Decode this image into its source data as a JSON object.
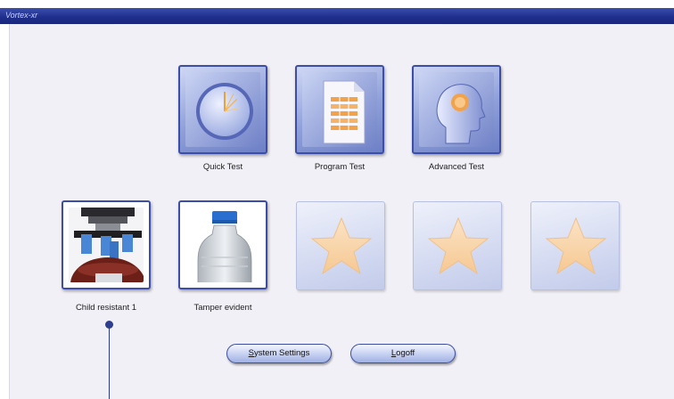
{
  "window": {
    "title": "Vortex-xr"
  },
  "tests": [
    {
      "label": "Quick Test",
      "icon": "clock-icon"
    },
    {
      "label": "Program Test",
      "icon": "document-icon"
    },
    {
      "label": "Advanced Test",
      "icon": "head-icon"
    }
  ],
  "programs": [
    {
      "label": "Child resistant 1",
      "icon": "child-resistant-fixture-icon"
    },
    {
      "label": "Tamper evident",
      "icon": "bottle-icon"
    },
    {
      "label": "",
      "icon": "star-icon"
    },
    {
      "label": "",
      "icon": "star-icon"
    },
    {
      "label": "",
      "icon": "star-icon"
    }
  ],
  "buttons": {
    "system_settings": {
      "mnemonic": "S",
      "rest": "ystem Settings"
    },
    "logoff": {
      "mnemonic": "L",
      "rest": "ogoff"
    }
  },
  "colors": {
    "titlebar": "#1f2f8d",
    "tile_border": "#3c4ea8",
    "background": "#f1f0f6"
  }
}
